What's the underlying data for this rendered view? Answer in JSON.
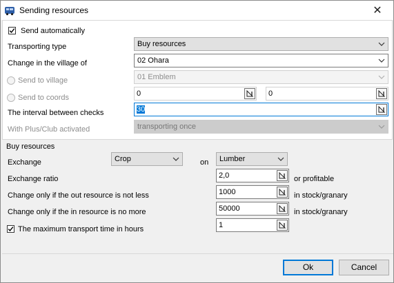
{
  "window": {
    "title": "Sending resources",
    "close_glyph": "✕"
  },
  "top": {
    "send_automatically": {
      "label": "Send automatically",
      "checked": true
    },
    "transporting_type": {
      "label": "Transporting type",
      "value": "Buy resources"
    },
    "change_village": {
      "label": "Change in the village of",
      "value": "02 Ohara"
    },
    "send_to_village": {
      "label": "Send to village",
      "value": "01 Emblem"
    },
    "send_to_coords": {
      "label": "Send to coords",
      "x": "0",
      "y": "0"
    },
    "interval": {
      "label": "The interval between checks",
      "value": "30"
    },
    "plus_club": {
      "label": "With Plus/Club activated",
      "value": "transporting once"
    }
  },
  "buy": {
    "group_label": "Buy resources",
    "exchange": {
      "label": "Exchange",
      "from": "Crop",
      "on_label": "on",
      "to": "Lumber"
    },
    "ratio": {
      "label": "Exchange ratio",
      "value": "2,0",
      "suffix": "or profitable"
    },
    "out_min": {
      "label": "Change only if the out resource is not less",
      "value": "1000",
      "suffix": "in stock/granary"
    },
    "in_max": {
      "label": "Change only if the in resource is no more",
      "value": "50000",
      "suffix": "in stock/granary"
    },
    "max_time": {
      "label": "The maximum transport time in hours",
      "value": "1",
      "checked": true
    }
  },
  "buttons": {
    "ok": "Ok",
    "cancel": "Cancel"
  },
  "colors": {
    "accent": "#0078d7",
    "face": "#f0f0f0"
  }
}
